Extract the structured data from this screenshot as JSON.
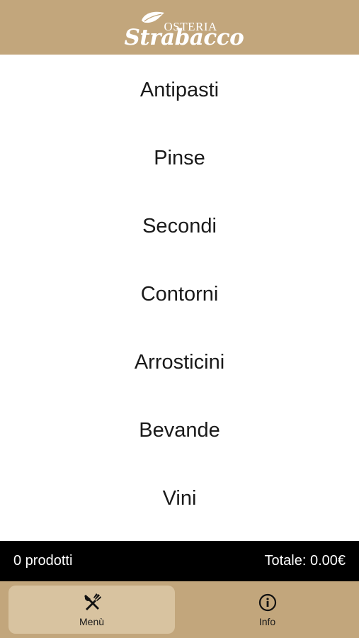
{
  "header": {
    "brand_top": "OSTERIA",
    "brand_main": "Strabacco",
    "background_color": "#c2a67c"
  },
  "menu": {
    "items": [
      {
        "label": "Antipasti"
      },
      {
        "label": "Pinse"
      },
      {
        "label": "Secondi"
      },
      {
        "label": "Contorni"
      },
      {
        "label": "Arrosticini"
      },
      {
        "label": "Bevande"
      },
      {
        "label": "Vini"
      }
    ]
  },
  "cart": {
    "count_text": "0 prodotti",
    "total_text": "Totale: 0.00€"
  },
  "bottom_nav": {
    "items": [
      {
        "label": "Menù",
        "icon": "fork-knife-icon",
        "active": true
      },
      {
        "label": "Info",
        "icon": "info-icon",
        "active": false
      }
    ]
  },
  "colors": {
    "accent": "#c2a67c",
    "active_tab": "#d8c3a0",
    "cart_bar": "#000000"
  }
}
